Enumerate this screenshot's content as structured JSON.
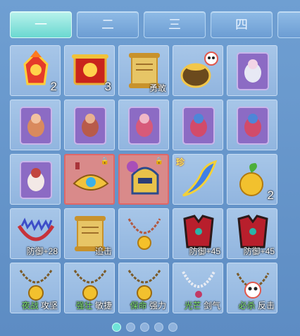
{
  "tabs": [
    {
      "label": "一",
      "active": true
    },
    {
      "label": "二",
      "active": false
    },
    {
      "label": "三",
      "active": false
    },
    {
      "label": "四",
      "active": false
    }
  ],
  "grid": {
    "rows": [
      [
        {
          "icon": "gold-fire-token-icon",
          "count": "2"
        },
        {
          "icon": "red-scroll-icon",
          "count": "3"
        },
        {
          "icon": "golden-scroll-icon",
          "label": "勇敢"
        },
        {
          "icon": "treasure-pot-icon"
        },
        {
          "icon": "pet-card-icon"
        }
      ],
      [
        {
          "icon": "pet-card-icon"
        },
        {
          "icon": "pet-card-icon"
        },
        {
          "icon": "pet-card-icon"
        },
        {
          "icon": "pet-card-icon"
        },
        {
          "icon": "pet-card-icon"
        }
      ],
      [
        {
          "icon": "pet-card-icon"
        },
        {
          "icon": "golden-crown-icon",
          "locked": true
        },
        {
          "icon": "golden-helmet-icon",
          "locked": true
        },
        {
          "icon": "blue-dragon-blade-icon",
          "badge": "珍"
        },
        {
          "icon": "golden-fruit-icon",
          "count": "2"
        }
      ],
      [
        {
          "icon": "spiked-necklace-icon",
          "label": "防御+28"
        },
        {
          "icon": "golden-scroll-icon",
          "label": "追击"
        },
        {
          "icon": "amulet-necklace-icon"
        },
        {
          "icon": "red-armor-icon",
          "label": "防御+45"
        },
        {
          "icon": "red-armor-icon",
          "label": "防御+45"
        }
      ],
      [
        {
          "icon": "gold-coin-necklace-icon",
          "label_green": "夜战",
          "label": "攻坚"
        },
        {
          "icon": "gold-coin-necklace-icon",
          "label_green": "强壮",
          "label": "敏捷"
        },
        {
          "icon": "gold-coin-necklace-icon",
          "label_green": "保命",
          "label": "强力"
        },
        {
          "icon": "silver-chain-icon",
          "label_green": "光芒",
          "label": "剑气"
        },
        {
          "icon": "panda-necklace-icon",
          "label_green": "必杀",
          "label": "反击"
        }
      ]
    ]
  },
  "pager": {
    "pages": 5,
    "current": 1
  },
  "colors": {
    "active_tab": "#6ad8d0",
    "background": "#6f9fd2",
    "cell": "#9dbde4"
  }
}
